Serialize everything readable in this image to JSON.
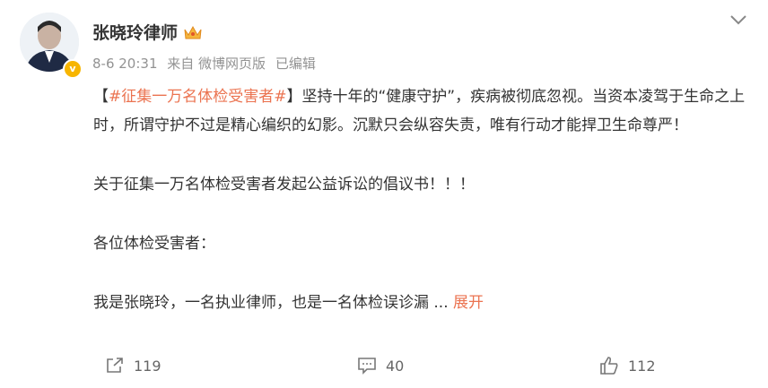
{
  "post": {
    "author_name": "张晓玲律师",
    "date": "8-6 20:31",
    "source": "来自 微博网页版",
    "edited": "已编辑",
    "tag_open": "【",
    "tag": "#征集一万名体检受害者#",
    "tag_close": "】",
    "line1_rest": "坚持十年的“健康守护”，疾病被彻底忽视。当资本凌驾于生命之上时，所谓守护不过是精心编织的幻影。沉默只会纵容失责，唯有行动才能捍卫生命尊严！",
    "para2": "关于征集一万名体检受害者发起公益诉讼的倡议书！！！",
    "para3": "各位体检受害者：",
    "para4": "我是张晓玲，一名执业律师，也是一名体检误诊漏",
    "ellipsis": " ...",
    "expand": "展开"
  },
  "actions": {
    "share_count": "119",
    "comment_count": "40",
    "like_count": "112"
  },
  "colors": {
    "accent": "#eb7350",
    "verified": "#f7b500",
    "meta": "#939393"
  },
  "icons": [
    "crown-icon",
    "chevron-down-icon",
    "share-icon",
    "comment-icon",
    "like-icon",
    "verified-badge-icon"
  ]
}
